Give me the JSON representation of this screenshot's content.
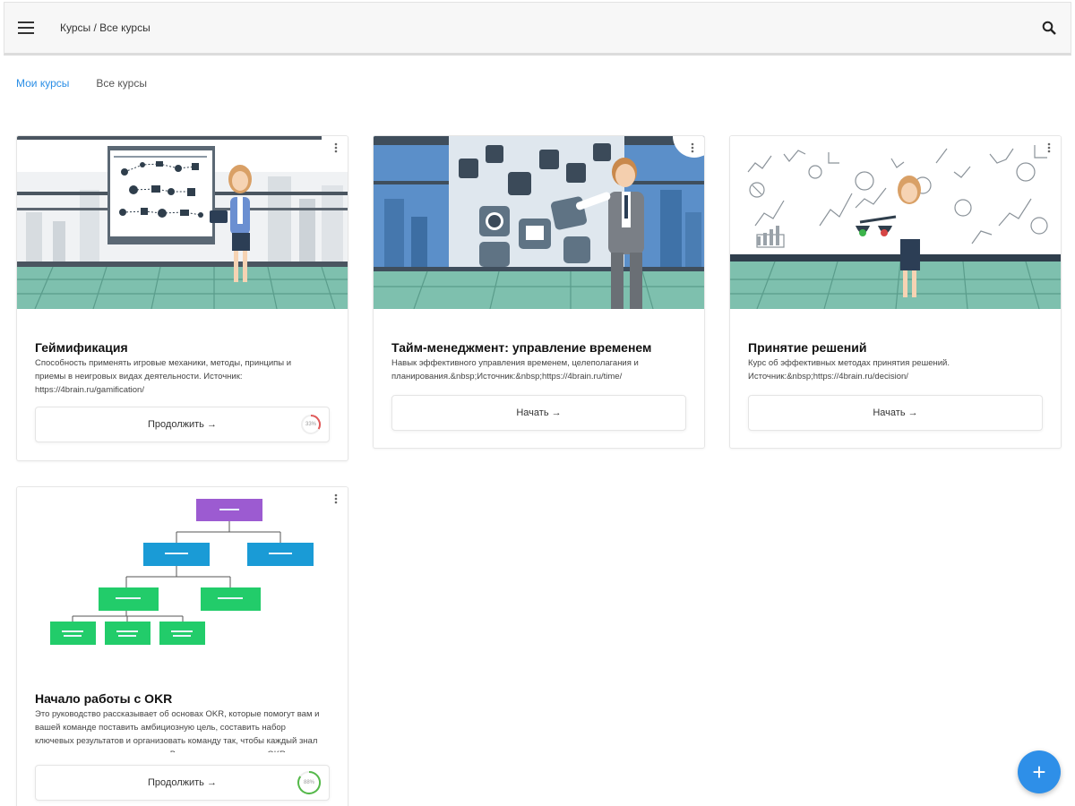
{
  "header": {
    "breadcrumb": "Курсы / Все курсы",
    "menu_icon": "hamburger-menu-icon",
    "search_icon": "search-icon"
  },
  "tabs": [
    {
      "label": "Мои курсы",
      "active": true
    },
    {
      "label": "Все курсы",
      "active": false
    }
  ],
  "courses": [
    {
      "title": "Геймификация",
      "description": "Способность применять игровые механики, методы, принципы и приемы в неигровых видах деятельности. Источник: https://4brain.ru/gamification/",
      "action_label": "Продолжить →",
      "progress": "33%"
    },
    {
      "title": "Тайм-менеджмент: управление временем",
      "description": "Навык эффективного управления временем, целеполагания и планирования.&nbsp;Источник:&nbsp;https://4brain.ru/time/",
      "action_label": "Начать →"
    },
    {
      "title": "Принятие решений",
      "description": "Курс об эффективных методах принятия решений. Источник:&nbsp;https://4brain.ru/decision/",
      "action_label": "Начать →"
    },
    {
      "title": "Начало работы с OKR",
      "description": "Это руководство рассказывает об основах OKR, которые помогут вам и вашей команде поставить амбициозную цель, составить набор ключевых результатов и организовать команду так, чтобы каждый знал что делать для достижения цели. В основном этого метод OKR",
      "action_label": "Продолжить →",
      "progress": "88%"
    }
  ],
  "fab": {
    "label": "+",
    "color": "#2e8fe8"
  },
  "colors": {
    "accent": "#2a8ee6",
    "floor": "#6fb8a5",
    "diagram_root": "#9c5bd1",
    "diagram_mid": "#1a9bd6",
    "diagram_leaf": "#22cc6a"
  }
}
